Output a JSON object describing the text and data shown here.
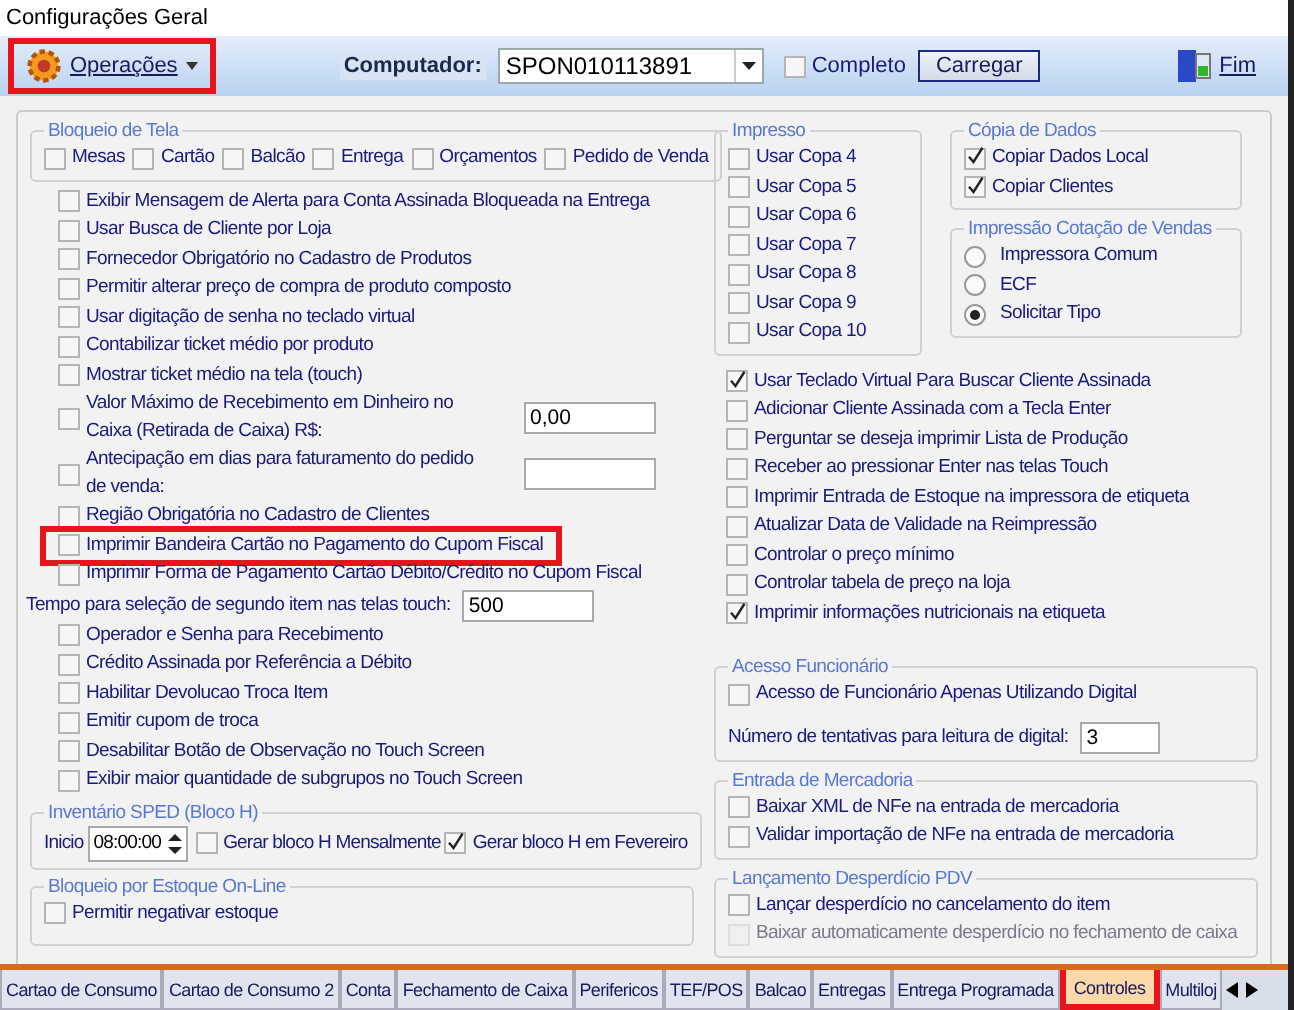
{
  "window": {
    "title": "Configurações Geral"
  },
  "toolbar": {
    "operations_menu": {
      "label": "Operações",
      "highlighted": true
    },
    "computer_label": "Computador:",
    "computer_value": "SPON010113891",
    "complete": {
      "label": "Completo",
      "checked": false
    },
    "load_button": "Carregar",
    "exit_button": "Fim"
  },
  "screen_lock": {
    "legend": "Bloqueio de Tela",
    "items": [
      {
        "label": "Mesas",
        "checked": false
      },
      {
        "label": "Cartão",
        "checked": false
      },
      {
        "label": "Balcão",
        "checked": false
      },
      {
        "label": "Entrega",
        "checked": false
      },
      {
        "label": "Orçamentos",
        "checked": false
      },
      {
        "label": "Pedido de Venda",
        "checked": false
      }
    ]
  },
  "left_options": [
    {
      "kind": "check",
      "label": "Exibir Mensagem de Alerta para Conta Assinada Bloqueada na Entrega",
      "checked": false,
      "highlighted": false
    },
    {
      "kind": "check",
      "label": "Usar Busca de Cliente por Loja",
      "checked": false,
      "highlighted": false
    },
    {
      "kind": "check",
      "label": "Fornecedor Obrigatório no Cadastro de Produtos",
      "checked": false,
      "highlighted": false
    },
    {
      "kind": "check",
      "label": "Permitir alterar preço de compra de produto composto",
      "checked": false,
      "highlighted": false
    },
    {
      "kind": "check",
      "label": "Usar digitação de senha no teclado virtual",
      "checked": false,
      "highlighted": false
    },
    {
      "kind": "check",
      "label": "Contabilizar ticket médio por produto",
      "checked": false,
      "highlighted": false
    },
    {
      "kind": "check",
      "label": "Mostrar ticket médio na tela (touch)",
      "checked": false,
      "highlighted": false
    },
    {
      "kind": "check_field",
      "label": "Valor Máximo de Recebimento em Dinheiro no Caixa (Retirada de Caixa) R$:",
      "value": "0,00",
      "checked": false,
      "highlighted": false
    },
    {
      "kind": "check_field",
      "label": "Antecipação em dias para faturamento do pedido de venda:",
      "checked": false,
      "highlighted": false
    },
    {
      "kind": "check",
      "label": "Região Obrigatória no Cadastro de Clientes",
      "checked": false,
      "highlighted": false
    },
    {
      "kind": "check",
      "label": "Imprimir Bandeira Cartão no Pagamento do Cupom Fiscal",
      "checked": false,
      "highlighted": true
    },
    {
      "kind": "check",
      "label": "Imprimir Forma de Pagamento Cartão Débito/Crédito no Cupom Fiscal",
      "checked": false,
      "highlighted": false
    },
    {
      "kind": "field",
      "label": "Tempo para seleção de segundo item nas telas touch:",
      "value": "500",
      "highlighted": false
    },
    {
      "kind": "check",
      "label": "Operador e Senha para Recebimento",
      "checked": false,
      "highlighted": false
    },
    {
      "kind": "check",
      "label": "Crédito Assinada por Referência a Débito",
      "checked": false,
      "highlighted": false
    },
    {
      "kind": "check",
      "label": "Habilitar Devolucao Troca Item",
      "checked": false,
      "highlighted": false
    },
    {
      "kind": "check",
      "label": "Emitir cupom de troca",
      "checked": false,
      "highlighted": false
    },
    {
      "kind": "check",
      "label": "Desabilitar Botão de Observação no Touch Screen",
      "checked": false,
      "highlighted": false
    },
    {
      "kind": "check",
      "label": "Exibir maior quantidade de subgrupos no Touch Screen",
      "checked": false,
      "highlighted": false
    }
  ],
  "inventory": {
    "legend": "Inventário SPED (Bloco H)",
    "start_label": "Inicio",
    "start_value": "08:00:00",
    "monthly": {
      "label": "Gerar bloco H Mensalmente",
      "checked": false
    },
    "february": {
      "label": "Gerar bloco H em Fevereiro",
      "checked": true
    }
  },
  "stock_lock": {
    "legend": "Bloqueio por Estoque On-Line",
    "items": [
      {
        "label": "Permitir negativar estoque",
        "checked": false
      }
    ]
  },
  "printed": {
    "legend": "Impresso",
    "items": [
      {
        "label": "Usar Copa 4",
        "checked": false
      },
      {
        "label": "Usar Copa 5",
        "checked": false
      },
      {
        "label": "Usar Copa 6",
        "checked": false
      },
      {
        "label": "Usar Copa 7",
        "checked": false
      },
      {
        "label": "Usar Copa 8",
        "checked": false
      },
      {
        "label": "Usar Copa 9",
        "checked": false
      },
      {
        "label": "Usar Copa 10",
        "checked": false
      }
    ]
  },
  "data_copy": {
    "legend": "Cópia de Dados",
    "items": [
      {
        "label": "Copiar Dados Local",
        "checked": true
      },
      {
        "label": "Copiar Clientes",
        "checked": true
      }
    ]
  },
  "quote_printing": {
    "legend": "Impressão Cotação de Vendas",
    "options": [
      {
        "label": "Impressora Comum",
        "selected": false
      },
      {
        "label": "ECF",
        "selected": false
      },
      {
        "label": "Solicitar Tipo",
        "selected": true
      }
    ]
  },
  "right_options": [
    {
      "label": "Usar Teclado Virtual Para Buscar Cliente Assinada",
      "checked": true
    },
    {
      "label": "Adicionar Cliente Assinada com a Tecla Enter",
      "checked": false
    },
    {
      "label": "Perguntar se deseja imprimir Lista de Produção",
      "checked": false
    },
    {
      "label": "Receber ao pressionar Enter nas telas Touch",
      "checked": false
    },
    {
      "label": "Imprimir Entrada de Estoque na impressora de etiqueta",
      "checked": false
    },
    {
      "label": "Atualizar Data de Validade na Reimpressão",
      "checked": false
    },
    {
      "label": "Controlar o preço mínimo",
      "checked": false
    },
    {
      "label": "Controlar tabela de preço na loja",
      "checked": false
    },
    {
      "label": "Imprimir informações nutricionais na etiqueta",
      "checked": true
    }
  ],
  "employee_access": {
    "legend": "Acesso Funcionário",
    "items": [
      {
        "label": "Acesso de Funcionário Apenas Utilizando Digital",
        "checked": false
      }
    ],
    "attempts_label": "Número de tentativas para leitura de digital:",
    "attempts_value": "3"
  },
  "goods_entry": {
    "legend": "Entrada de Mercadoria",
    "items": [
      {
        "label": "Baixar XML de NFe na entrada de mercadoria",
        "checked": false
      },
      {
        "label": "Validar importação de NFe na entrada de mercadoria",
        "checked": false
      }
    ]
  },
  "waste": {
    "legend": "Lançamento Desperdício PDV",
    "items": [
      {
        "label": "Lançar desperdício no cancelamento do item",
        "checked": false,
        "disabled": false
      },
      {
        "label": "Baixar automaticamente desperdício no fechamento de caixa",
        "checked": false,
        "disabled": true
      }
    ]
  },
  "tabs": [
    {
      "label": "Cartao de Consumo",
      "selected": false,
      "highlighted": false
    },
    {
      "label": "Cartao de Consumo 2",
      "selected": false,
      "highlighted": false
    },
    {
      "label": "Conta",
      "selected": false,
      "highlighted": false
    },
    {
      "label": "Fechamento de Caixa",
      "selected": false,
      "highlighted": false
    },
    {
      "label": "Perifericos",
      "selected": false,
      "highlighted": false
    },
    {
      "label": "TEF/POS",
      "selected": false,
      "highlighted": false
    },
    {
      "label": "Balcao",
      "selected": false,
      "highlighted": false
    },
    {
      "label": "Entregas",
      "selected": false,
      "highlighted": false
    },
    {
      "label": "Entrega Programada",
      "selected": false,
      "highlighted": false
    },
    {
      "label": "Controles",
      "selected": true,
      "highlighted": true
    },
    {
      "label": "Multiloj",
      "selected": false,
      "highlighted": false
    }
  ]
}
